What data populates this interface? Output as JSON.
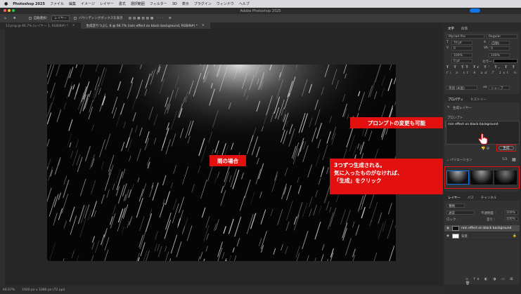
{
  "menubar": {
    "items": [
      "Photoshop 2025",
      "ファイル",
      "編集",
      "イメージ",
      "レイヤー",
      "書式",
      "選択範囲",
      "フィルター",
      "3D",
      "表示",
      "プラグイン",
      "ウィンドウ",
      "ヘルプ"
    ]
  },
  "titlebar": {
    "title": "Adobe Photoshop 2025"
  },
  "options": {
    "select_label": "自動選択：",
    "layer_dropdown": "レイヤー",
    "transform_label": "バウンディングボックスを表示"
  },
  "doc_tabs": [
    {
      "label": "13.png @ 66.7% (レイヤー 1, RGB/8#) *",
      "active": false
    },
    {
      "label": "生成塗りつぶし 8 @ 66.7% (rain effect on black background, RGB/8#) *",
      "active": true
    }
  ],
  "status": {
    "zoom": "66.67%",
    "docsize": "1920 px x 1080 px (72 ppi)"
  },
  "character_panel": {
    "tabs": [
      "文字",
      "段落"
    ],
    "font_family": "Myriad Pro",
    "font_style": "Regular",
    "size": "70 pt",
    "leading": "(自動)",
    "kerning": "0",
    "tracking": "0",
    "vscale": "100%",
    "hscale": "100%",
    "baseline": "0 pt",
    "color_label": "カラー :",
    "lang": "英語 (米国)",
    "aa": "シャープ",
    "aa_label": "aa"
  },
  "properties_panel": {
    "tabs": [
      "プロパティ",
      "ヒストリー"
    ],
    "layer_type": "生成レイヤー",
    "prompt_label": "プロンプト",
    "prompt_text": "rain effect on black background",
    "generate_label": "生成",
    "variations_label": "バリエーション",
    "variations_count": "1/3"
  },
  "layers_panel": {
    "tabs": [
      "レイヤー",
      "パス",
      "チャンネル"
    ],
    "kind": "種類",
    "blend": "通常",
    "opacity_label": "不透明度 :",
    "opacity": "100%",
    "lock_label": "ロック :",
    "fill_label": "塗り :",
    "fill": "100%",
    "layers": [
      {
        "name": "rain effect on black background",
        "selected": true
      },
      {
        "name": "背景",
        "selected": false
      }
    ]
  },
  "annotations": {
    "canvas_label": "雨の場合",
    "prompt_callout": "プロンプトの変更も可能",
    "variation_callout": [
      "3つずつ生成される。",
      "気に入ったものがなければ、",
      "「生成」をクリック"
    ]
  },
  "colors": {
    "accent_red": "#e31010",
    "ps_blue": "#1473e6"
  }
}
